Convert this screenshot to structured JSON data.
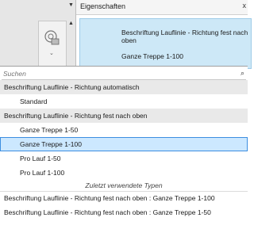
{
  "properties": {
    "title": "Eigenschaften",
    "close_glyph": "x",
    "type_selector": {
      "line1": "Beschriftung Lauflinie - Richtung fest nach oben",
      "line2": "Ganze Treppe 1-100"
    }
  },
  "search": {
    "placeholder": "Suchen",
    "icon": "search-icon"
  },
  "list": {
    "group1": "Beschriftung Lauflinie - Richtung automatisch",
    "group1_items": [
      "Standard"
    ],
    "group2": "Beschriftung Lauflinie - Richtung fest nach oben",
    "group2_items": [
      "Ganze Treppe 1-50",
      "Ganze Treppe 1-100",
      "Pro Lauf 1-50",
      "Pro Lauf 1-100"
    ],
    "selected_item": "Ganze Treppe 1-100",
    "recent_header": "Zuletzt verwendete Typen",
    "recent_items": [
      "Beschriftung Lauflinie - Richtung fest nach oben : Ganze Treppe 1-100",
      "Beschriftung Lauflinie - Richtung fest nach oben : Ganze Treppe 1-50"
    ]
  },
  "colors": {
    "selection": "#cce8ff",
    "selection_border": "#3d8ee0",
    "group_background": "#e9e9e9"
  }
}
